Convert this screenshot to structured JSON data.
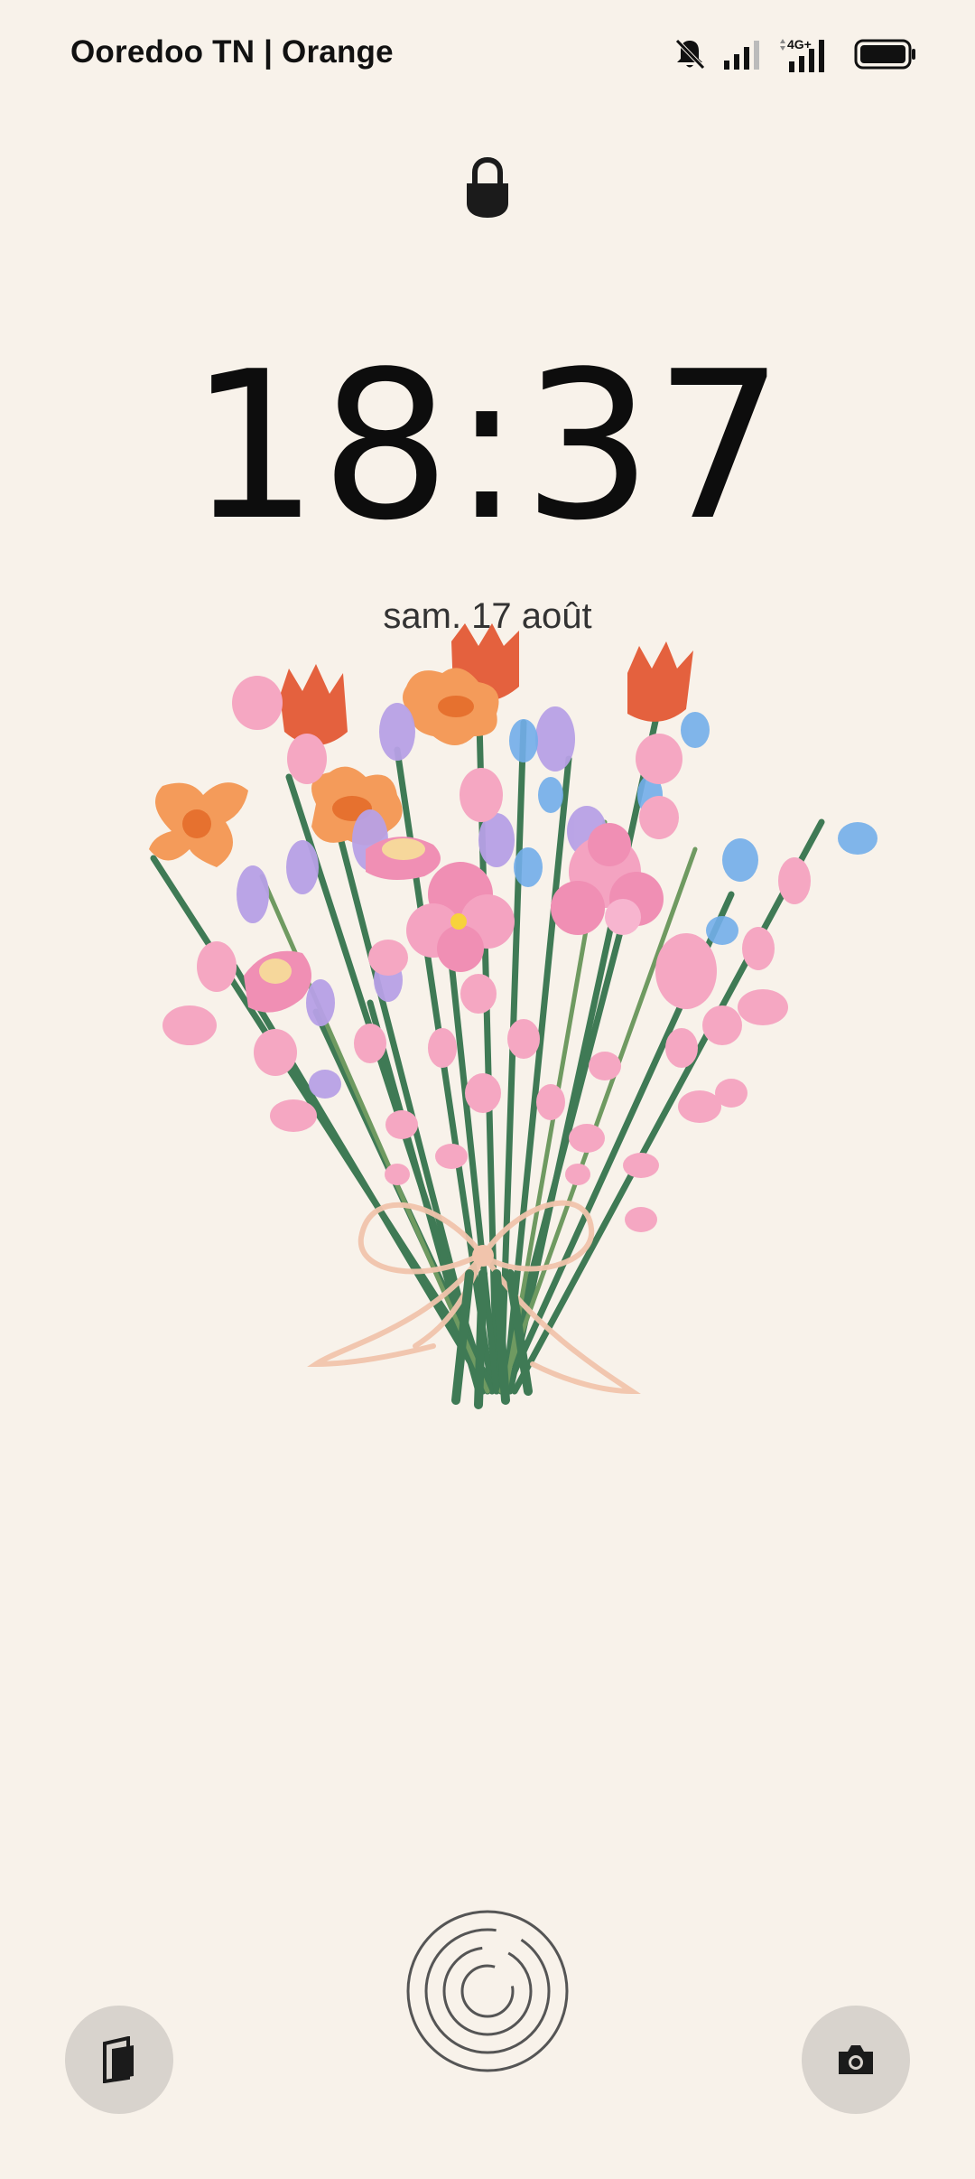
{
  "status_bar": {
    "carrier": "Ooredoo TN | Orange",
    "network_type": "4G+",
    "icons": [
      "notifications-off-icon",
      "signal-icon",
      "signal-4g-icon",
      "battery-icon"
    ]
  },
  "lock_screen": {
    "lock_icon": "lock-icon",
    "time": "18:37",
    "date": "sam. 17 août"
  },
  "bottom": {
    "left_icon": "wallet-icon",
    "center_icon": "fingerprint-icon",
    "right_icon": "camera-icon"
  },
  "colors": {
    "background": "#F8F2EA",
    "button_bg": "#D8D3CD",
    "text": "#0d0d0d"
  }
}
